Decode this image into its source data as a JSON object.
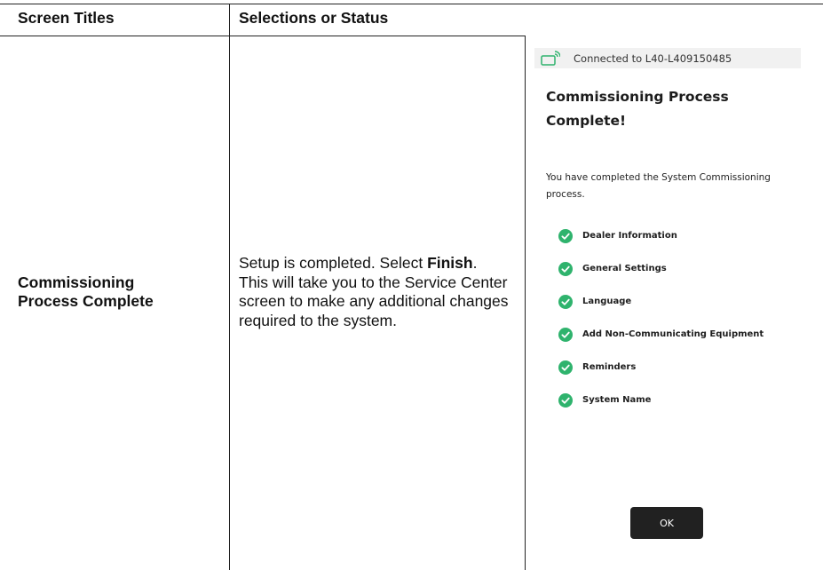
{
  "table": {
    "headers": [
      "Screen Titles",
      "Selections or Status"
    ],
    "row": {
      "title": "Commissioning Process Complete",
      "description_before": "Setup is completed. Select ",
      "description_bold": "Finish",
      "description_after": ". This will take you to the Service Center screen to make any additional changes required to the system."
    }
  },
  "screen": {
    "connection_text": "Connected to L40-L409150485",
    "title": "Commissioning Process Complete!",
    "description": "You have completed the System Commissioning process.",
    "checklist": [
      "Dealer Information",
      "General Settings",
      "Language",
      "Add Non-Communicating Equipment",
      "Reminders",
      "System Name"
    ],
    "ok_label": "OK",
    "icons": {
      "connection": "wifi-device-icon",
      "check": "check-circle-icon"
    },
    "colors": {
      "accent_green": "#2fb36d",
      "button": "#212121"
    }
  }
}
